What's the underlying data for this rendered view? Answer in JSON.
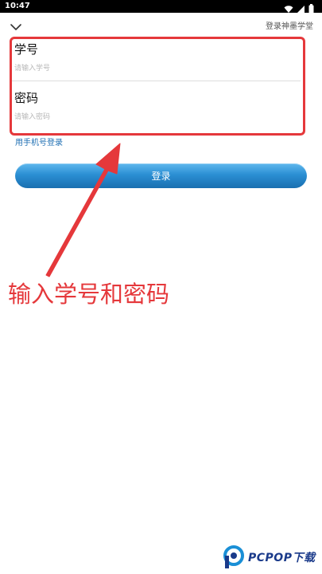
{
  "status_bar": {
    "time": "10:47",
    "icons": [
      "wifi-icon",
      "signal-icon",
      "battery-icon"
    ]
  },
  "header": {
    "back_icon": "chevron-down-icon",
    "title": "登录神墨学堂"
  },
  "form": {
    "username": {
      "label": "学号",
      "placeholder": "请输入学号",
      "value": ""
    },
    "password": {
      "label": "密码",
      "placeholder": "请输入密码",
      "value": ""
    }
  },
  "phone_login_link": "用手机号登录",
  "login_button": "登录",
  "annotation": {
    "text": "输入学号和密码",
    "color": "#e5383b"
  },
  "watermark": {
    "text": "PCPOP下载",
    "color": "#1a3a8a"
  },
  "colors": {
    "accent": "#2b8fd3",
    "link": "#1f6fb3",
    "highlight": "#e5383b"
  }
}
